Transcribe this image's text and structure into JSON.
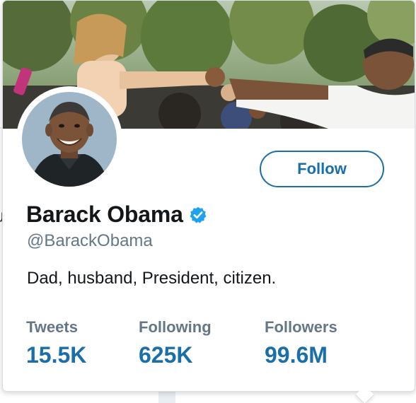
{
  "profile": {
    "display_name": "Barack Obama",
    "handle": "@BarackObama",
    "bio": "Dad, husband, President, citizen.",
    "verified": true
  },
  "actions": {
    "follow_label": "Follow"
  },
  "stats": [
    {
      "label": "Tweets",
      "value": "15.5K"
    },
    {
      "label": "Following",
      "value": "625K"
    },
    {
      "label": "Followers",
      "value": "99.6M"
    }
  ],
  "icons": {
    "verified": "verified-badge-icon"
  },
  "colors": {
    "accent": "#1b6fa8",
    "verified": "#1da1f2",
    "text_primary": "#14171a",
    "text_secondary": "#657786"
  }
}
